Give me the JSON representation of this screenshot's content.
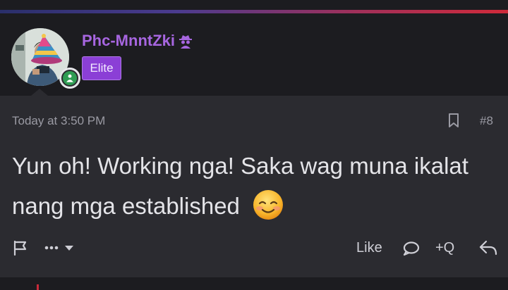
{
  "post": {
    "author": {
      "username": "Phc-MnntZki",
      "badge": "Elite",
      "avatar_icon": "avatar-photo",
      "online_icon": "online-status-icon",
      "hat_icon": "party-hat-icon",
      "username_icon": "spy-icon"
    },
    "timestamp": "Today at 3:50 PM",
    "post_number": "#8",
    "message": "Yun oh! Working nga! Saka wag muna ikalat nang mga established",
    "emoji": "smiling-face-emoji",
    "actions": {
      "report_icon": "flag-icon",
      "more_icon": "more-options-icon",
      "like_label": "Like",
      "comment_icon": "comment-icon",
      "quote_label": "+Q",
      "reply_icon": "reply-icon",
      "bookmark_icon": "bookmark-icon"
    }
  },
  "colors": {
    "username": "#a766e0",
    "badge_bg": "#8b3fd6",
    "online": "#2f9c53",
    "post_bg": "#2b2b30",
    "text": "#e4e4e8",
    "muted": "#9a9aa3"
  }
}
